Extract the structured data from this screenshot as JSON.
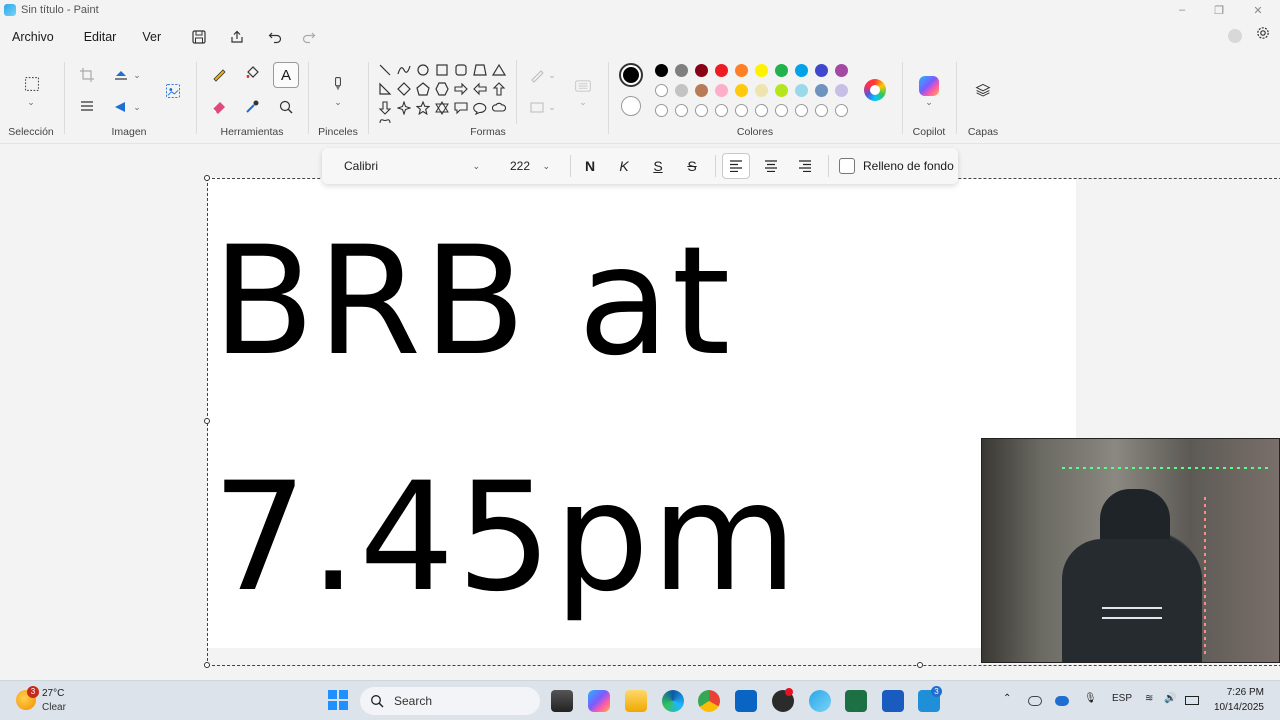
{
  "window": {
    "title": "Sin título - Paint",
    "minimize": "–",
    "maximize": "❐",
    "close": "✕"
  },
  "menu": {
    "items": [
      "Archivo",
      "Editar",
      "Ver"
    ]
  },
  "ribbon": {
    "groups": {
      "seleccion": "Selección",
      "imagen": "Imagen",
      "herramientas": "Herramientas",
      "pinceles": "Pinceles",
      "formas": "Formas",
      "colores": "Colores",
      "copilot": "Copilot",
      "capas": "Capas"
    },
    "active_color": "#000000",
    "palette_row1": [
      "#000000",
      "#7f7f7f",
      "#880015",
      "#ed1c24",
      "#ff7f27",
      "#fff200",
      "#22b14c",
      "#00a2e8",
      "#3f48cc",
      "#a349a4"
    ],
    "palette_row2": [
      "#ffffff",
      "#c3c3c3",
      "#b97a57",
      "#ffaec9",
      "#ffc90e",
      "#efe4b0",
      "#b5e61d",
      "#99d9ea",
      "#7092be",
      "#c8bfe7"
    ],
    "palette_row3_count": 10
  },
  "textbar": {
    "font": "Calibri",
    "size": "222",
    "bold": "N",
    "italic": "K",
    "underline": "S",
    "strike": "S",
    "fill_label": "Relleno de fondo"
  },
  "canvas": {
    "line1": "BRB at",
    "line2": "7.45pm"
  },
  "taskbar": {
    "weather_temp": "27°C",
    "weather_desc": "Clear",
    "weather_badge": "3",
    "search_placeholder": "Search",
    "teams_badge": "3",
    "lang": "ESP",
    "time": "7:26 PM",
    "date": "10/14/2025"
  }
}
